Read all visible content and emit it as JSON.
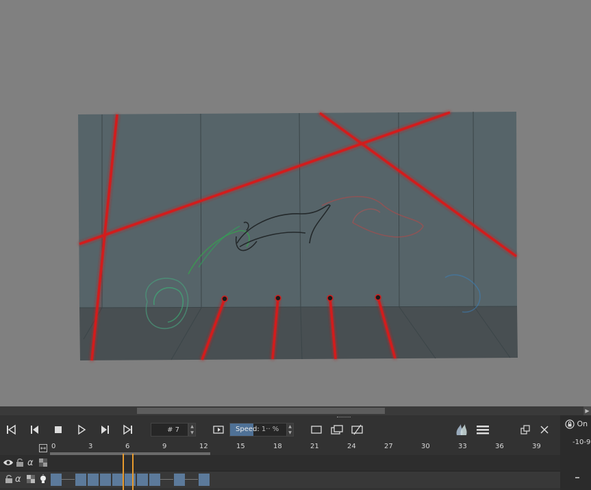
{
  "playback": {
    "frame_number": "# 7",
    "speed_label": "Speed:",
    "speed_value": "1·· %",
    "speed_fill_fraction": 0.41
  },
  "timeline": {
    "ticks": [
      "0",
      "3",
      "6",
      "9",
      "12",
      "15",
      "18",
      "21",
      "24",
      "27",
      "30",
      "33",
      "36",
      "39"
    ],
    "current_frame": 6,
    "keyframes": [
      0,
      2,
      3,
      4,
      5,
      6,
      7,
      8,
      10,
      12
    ]
  },
  "side": {
    "lock_label": "On",
    "range_label": "-10-9"
  },
  "colors": {
    "laser": "#d21f1f",
    "wall": "#566469",
    "floor": "#484f52",
    "keyframe": "#5c7a9b",
    "cursor": "#e89b2d"
  },
  "icons": [
    "first-frame-icon",
    "prev-frame-icon",
    "stop-icon",
    "play-icon",
    "next-frame-icon",
    "last-frame-icon",
    "loop-icon",
    "frame-icon",
    "onion-frames-icon",
    "no-frame-icon",
    "onion-skin-icon",
    "menu-icon",
    "float-icon",
    "close-icon",
    "lock-icon",
    "eye-icon",
    "alpha-icon",
    "checker-icon",
    "bulb-icon"
  ]
}
